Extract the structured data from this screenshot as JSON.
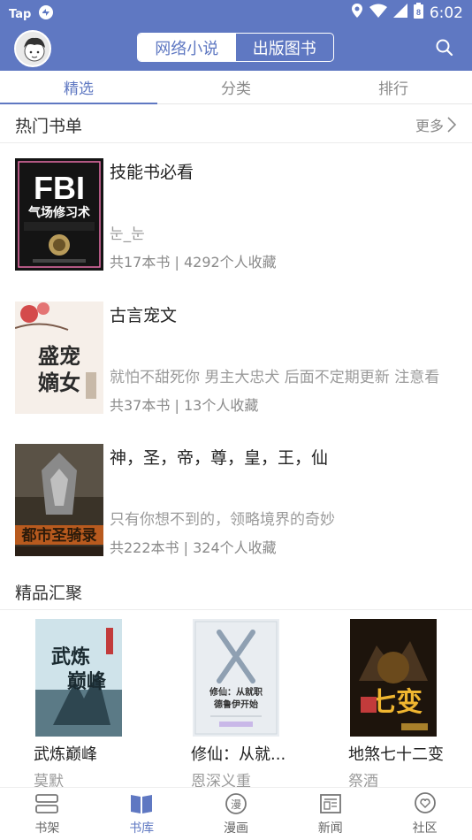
{
  "status_bar": {
    "carrier": "Tap",
    "time": "6:02",
    "battery": "8"
  },
  "header": {
    "segments": [
      "网络小说",
      "出版图书"
    ],
    "active_segment": "网络小说",
    "icons": {
      "avatar": "avatar-icon",
      "search": "search-icon"
    }
  },
  "tabs": [
    "精选",
    "分类",
    "排行"
  ],
  "active_tab": "精选",
  "hot": {
    "title": "热门书单",
    "more": "更多",
    "items": [
      {
        "cover_text": "FBI 气场修习术",
        "title": "技能书必看",
        "desc": "눈_눈",
        "count": "共17本书",
        "fav": "4292个人收藏"
      },
      {
        "cover_text": "盛宠嫡女",
        "title": "古言宠文",
        "desc": "就怕不甜死你 男主大忠犬 后面不定期更新 注意看县是? 看上哪本你领去吧",
        "count": "共37本书",
        "fav": "13个人收藏"
      },
      {
        "cover_text": "都市圣骑录",
        "title": "神，圣，帝，尊，皇，王，仙",
        "desc": "只有你想不到的，领略境界的奇妙",
        "count": "共222本书",
        "fav": "324个人收藏"
      }
    ]
  },
  "featured": {
    "title": "精品汇聚",
    "books": [
      {
        "title": "武炼巅峰",
        "author": "莫默",
        "cover_text": "武炼巅峰"
      },
      {
        "title": "修仙：从就...",
        "author": "恩深义重",
        "cover_text": "修仙：从就职德鲁伊开始"
      },
      {
        "title": "地煞七十二变",
        "author": "祭酒",
        "cover_text": "地煞七十二变"
      }
    ]
  },
  "bottom_nav": [
    "书架",
    "书库",
    "漫画",
    "新闻",
    "社区"
  ],
  "active_nav": "书库",
  "colors": {
    "accent": "#5f78c2"
  }
}
